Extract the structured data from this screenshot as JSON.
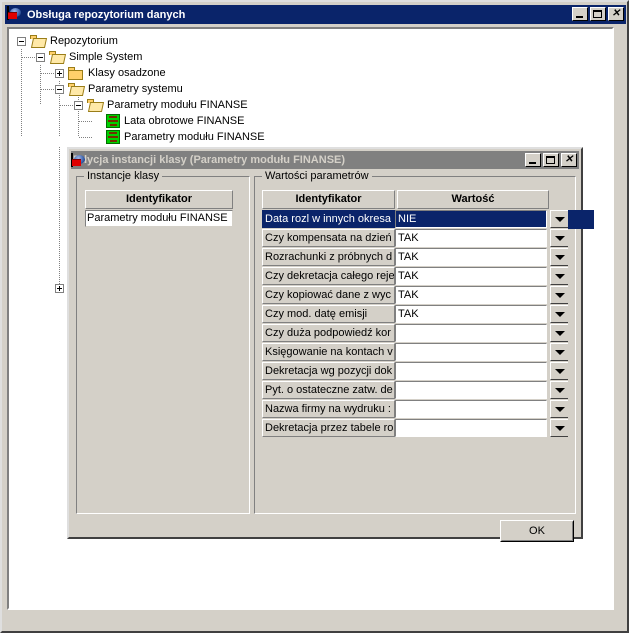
{
  "main_window": {
    "title": "Obsługa repozytorium danych",
    "icon": "app-globe-icon",
    "buttons": {
      "minimize": "_",
      "maximize": "□",
      "close": "✕"
    }
  },
  "tree": {
    "nodes": [
      {
        "label": "Repozytorium",
        "level": 0,
        "expander": "minus",
        "icon": "folder-open-icon"
      },
      {
        "label": "Simple System",
        "level": 1,
        "expander": "minus",
        "icon": "folder-open-icon"
      },
      {
        "label": "Klasy osadzone",
        "level": 2,
        "expander": "plus",
        "icon": "folder-closed-icon"
      },
      {
        "label": "Parametry systemu",
        "level": 2,
        "expander": "minus",
        "icon": "folder-open-icon"
      },
      {
        "label": "Parametry modułu FINANSE",
        "level": 3,
        "expander": "minus",
        "icon": "folder-open-icon"
      },
      {
        "label": "Lata obrotowe FINANSE",
        "level": 4,
        "expander": "none",
        "icon": "class-leaf-icon"
      },
      {
        "label": "Parametry modułu FINANSE",
        "level": 4,
        "expander": "none",
        "icon": "class-leaf-icon"
      }
    ],
    "extra_expander": {
      "expander": "plus"
    }
  },
  "dialog": {
    "title": "Edycja instancji klasy (Parametry modułu FINANSE)",
    "icon": "app-globe-icon",
    "buttons": {
      "minimize": "_",
      "maximize": "□",
      "close": "✕"
    },
    "instances_group": {
      "legend": "Instancje klasy",
      "column_header": "Identyfikator",
      "items": [
        "Parametry modułu FINANSE"
      ]
    },
    "params_group": {
      "legend": "Wartości parametrów",
      "columns": [
        "Identyfikator",
        "Wartość"
      ],
      "rows": [
        {
          "name": "Data rozl w innych okresa",
          "value": "NIE",
          "selected": true
        },
        {
          "name": "Czy kompensata na dzień",
          "value": "TAK",
          "selected": false
        },
        {
          "name": "Rozrachunki z próbnych d",
          "value": "TAK",
          "selected": false
        },
        {
          "name": "Czy dekretacja całego reje",
          "value": "TAK",
          "selected": false
        },
        {
          "name": "Czy kopiować dane z wyc",
          "value": "TAK",
          "selected": false
        },
        {
          "name": "Czy mod. datę emisji",
          "value": "TAK",
          "selected": false
        },
        {
          "name": "Czy duża podpowiedź kor",
          "value": "",
          "selected": false
        },
        {
          "name": "Księgowanie na kontach v",
          "value": "",
          "selected": false
        },
        {
          "name": "Dekretacja wg pozycji dok",
          "value": "",
          "selected": false
        },
        {
          "name": "Pyt. o ostateczne zatw. de",
          "value": "",
          "selected": false
        },
        {
          "name": "Nazwa firmy na wydruku :",
          "value": "",
          "selected": false
        },
        {
          "name": "Dekretacja przez tabele ro",
          "value": "",
          "selected": false
        }
      ],
      "dropdown_icon": "chevron-down-icon"
    },
    "ok_button": "OK"
  },
  "colors": {
    "title_active": "#0a246a",
    "title_inactive": "#808080",
    "face": "#d4d0c8",
    "selection": "#0a246a",
    "leaf_icon": "#00d000"
  }
}
